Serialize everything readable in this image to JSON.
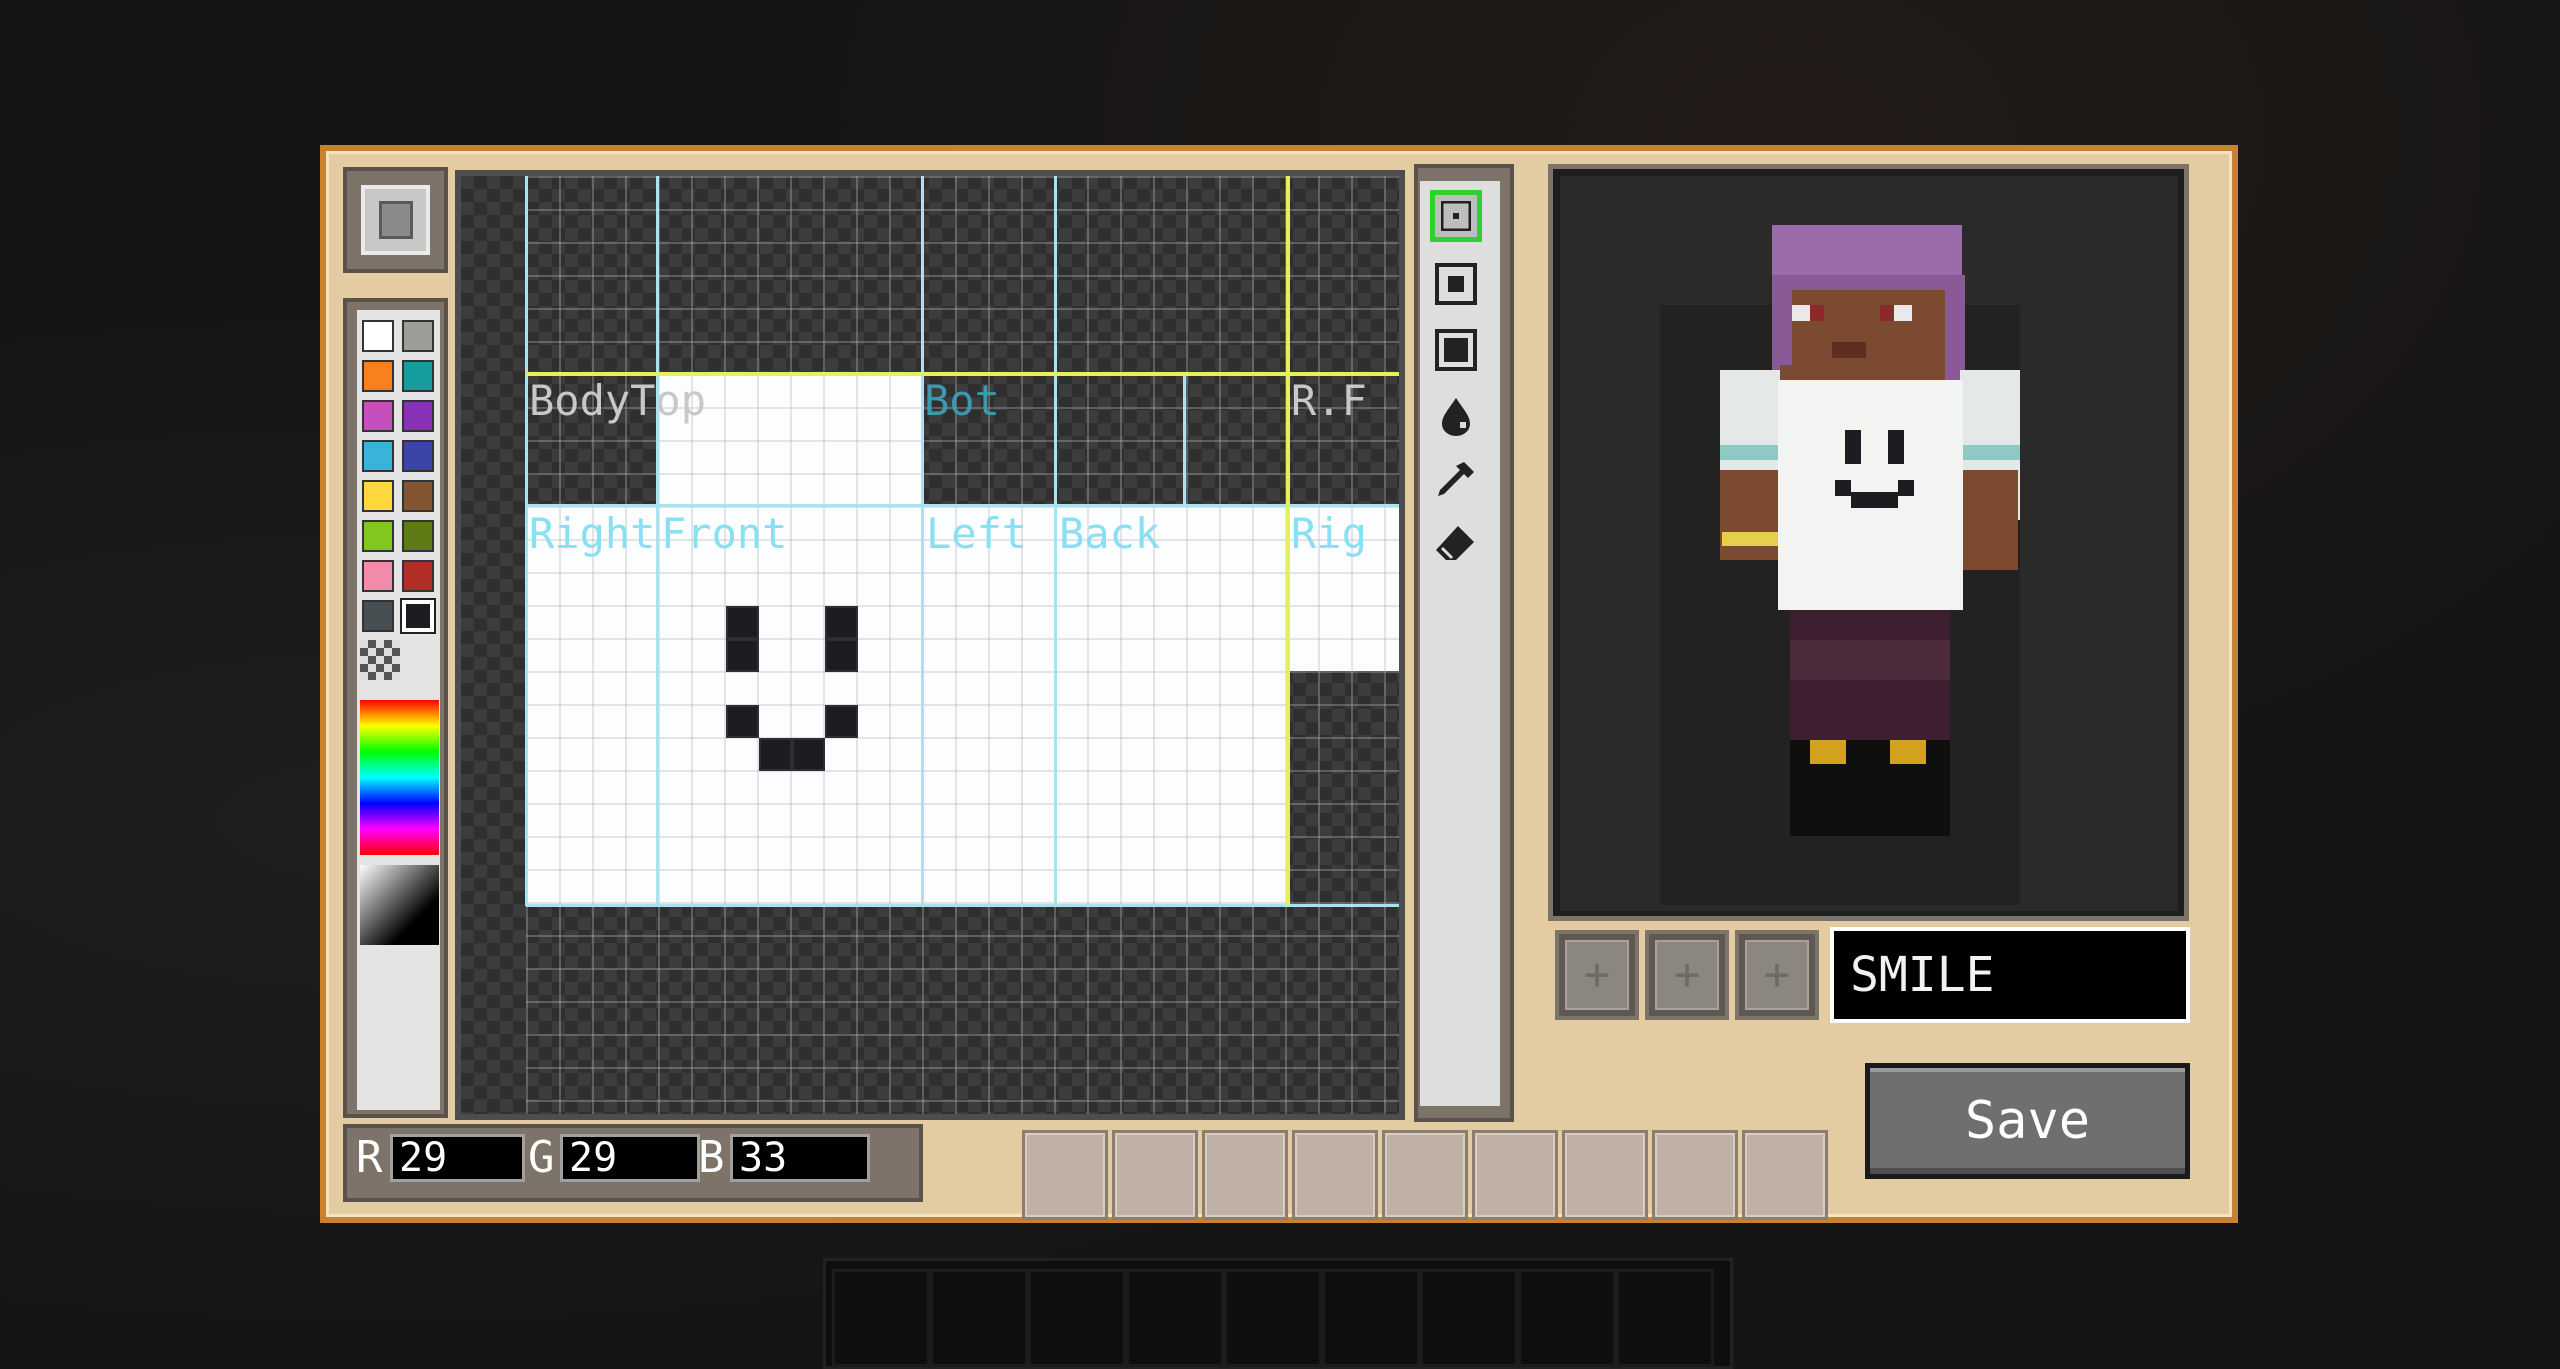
{
  "editor": {
    "mode_icon": "skin-editor-icon",
    "canvas": {
      "labels": {
        "body_top": "BodyTop",
        "bot": "Bot",
        "r_f": "R.F",
        "right": "Right",
        "front": "Front",
        "left": "Left",
        "back": "Back",
        "rig": "Rig"
      }
    },
    "palette": {
      "colors": [
        "#ffffff",
        "#9d9d97",
        "#f9801d",
        "#169c9c",
        "#c74ebd",
        "#8932b8",
        "#3ab3da",
        "#3c44aa",
        "#fed83d",
        "#835432",
        "#80c71f",
        "#5e7c16",
        "#f38baa",
        "#b02e26",
        "#474f52",
        "#1d1d21"
      ],
      "selected_color": "#1d1d21"
    },
    "rgb": {
      "r_label": "R",
      "g_label": "G",
      "b_label": "B",
      "r": "29",
      "g": "29",
      "b": "33"
    },
    "tools": [
      {
        "name": "pencil-small-tool-icon",
        "selected": true
      },
      {
        "name": "pencil-medium-tool-icon",
        "selected": false
      },
      {
        "name": "pencil-large-tool-icon",
        "selected": false
      },
      {
        "name": "fill-bucket-tool-icon",
        "selected": false
      },
      {
        "name": "eyedropper-tool-icon",
        "selected": false
      },
      {
        "name": "eraser-tool-icon",
        "selected": false
      }
    ]
  },
  "preview": {
    "layer_buttons": [
      "+",
      "+",
      "+"
    ],
    "design_name": "SMILE"
  },
  "actions": {
    "save_label": "Save"
  },
  "inventory": {
    "slot_count": 9
  }
}
